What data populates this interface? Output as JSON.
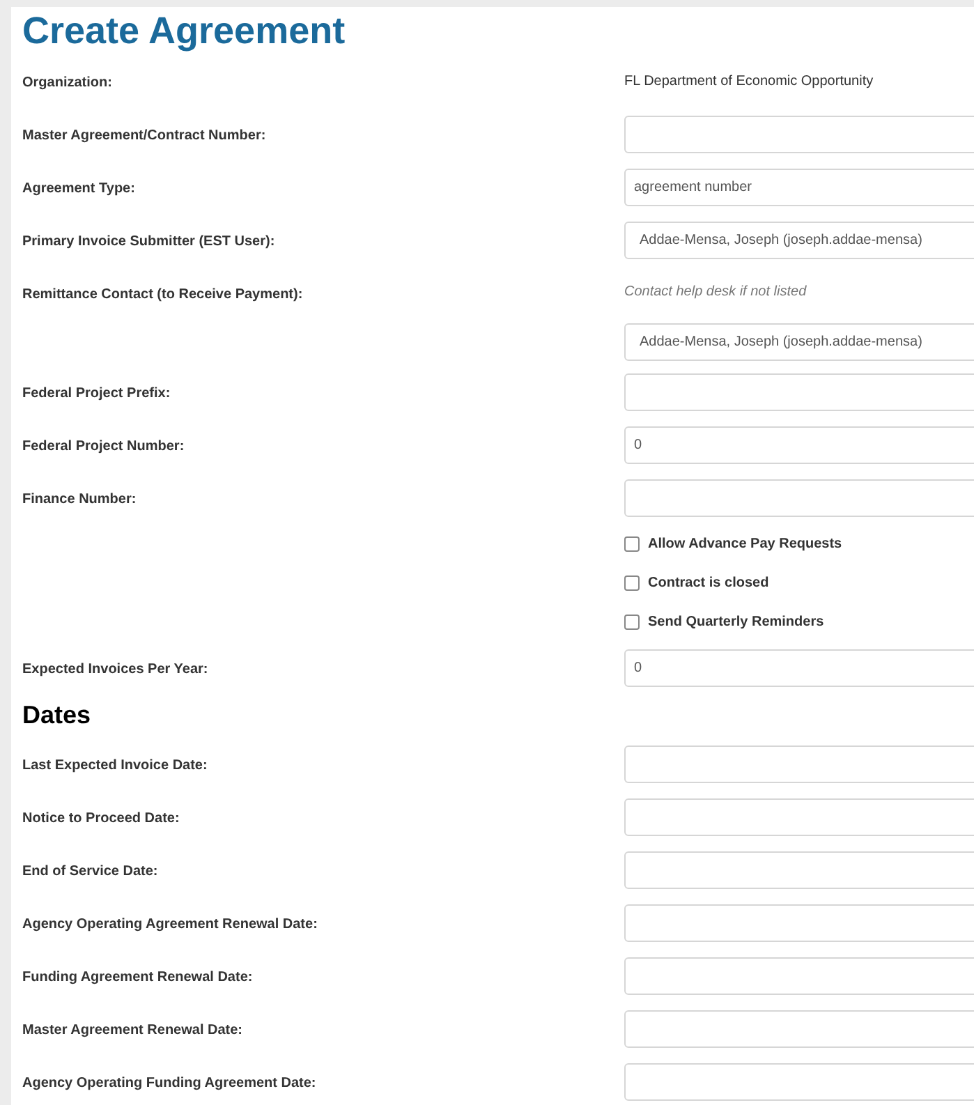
{
  "title": "Create Agreement",
  "rows": [
    {
      "kind": "text",
      "label": "Organization:",
      "value": "FL Department of Economic Opportunity"
    },
    {
      "kind": "input",
      "label": "Master Agreement/Contract Number:"
    },
    {
      "kind": "input",
      "label": "Agreement Type:",
      "value": "agreement number"
    },
    {
      "kind": "input",
      "label": "Primary Invoice Submitter (EST User):",
      "value": "Addae-Mensa, Joseph (joseph.addae-mensa)"
    },
    {
      "kind": "note",
      "label": "Remittance Contact (to Receive Payment):",
      "value": "Contact help desk if not listed"
    },
    {
      "kind": "input",
      "value": "Addae-Mensa, Joseph (joseph.addae-mensa)"
    },
    {
      "kind": "input",
      "label": "Federal Project Prefix:"
    },
    {
      "kind": "input",
      "label": "Federal Project Number:",
      "value": "0"
    },
    {
      "kind": "input",
      "label": "Finance Number:"
    },
    {
      "kind": "checkbox",
      "label": "Allow Advance Pay Requests",
      "checked": false
    },
    {
      "kind": "checkbox",
      "label": "Contract is closed",
      "checked": false
    },
    {
      "kind": "checkbox",
      "label": "Send Quarterly Reminders",
      "checked": false
    },
    {
      "kind": "input",
      "label": "Expected Invoices Per Year:",
      "value": "0"
    }
  ],
  "dates": {
    "heading": "Dates",
    "rows": [
      {
        "label": "Last Expected Invoice Date:"
      },
      {
        "label": "Notice to Proceed Date:"
      },
      {
        "label": "End of Service Date:"
      },
      {
        "label": "Agency Operating Agreement Renewal Date:"
      },
      {
        "label": "Funding Agreement Renewal Date:"
      },
      {
        "label": "Master Agreement Renewal Date:"
      },
      {
        "label": "Agency Operating Funding Agreement Date:"
      }
    ]
  }
}
